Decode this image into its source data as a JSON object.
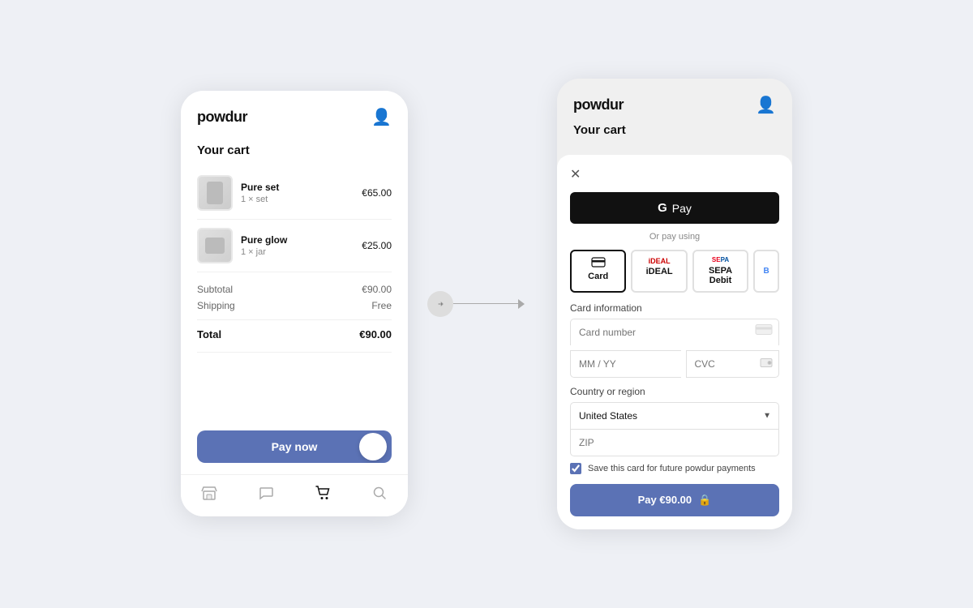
{
  "left_phone": {
    "logo": "powdur",
    "avatar_icon": "👤",
    "cart_title": "Your cart",
    "items": [
      {
        "name": "Pure set",
        "qty": "1 × set",
        "price": "€65.00",
        "img_type": "pure-set"
      },
      {
        "name": "Pure glow",
        "qty": "1 × jar",
        "price": "€25.00",
        "img_type": "pure-glow"
      }
    ],
    "subtotal_label": "Subtotal",
    "subtotal_value": "€90.00",
    "shipping_label": "Shipping",
    "shipping_value": "Free",
    "total_label": "Total",
    "total_value": "€90.00",
    "pay_button_label": "Pay now",
    "nav": {
      "store_icon": "🏪",
      "chat_icon": "💬",
      "cart_icon": "🛒",
      "search_icon": "🔍"
    }
  },
  "arrow": {
    "direction": "→"
  },
  "right_phone": {
    "logo": "powdur",
    "avatar_icon": "👤",
    "cart_title": "Your cart",
    "modal": {
      "close_icon": "✕",
      "gpay_label": "Pay",
      "gpay_g": "G",
      "or_text": "Or pay using",
      "payment_methods": [
        {
          "id": "card",
          "label": "Card",
          "selected": true
        },
        {
          "id": "ideal",
          "label": "iDEAL",
          "selected": false
        },
        {
          "id": "sepa",
          "label": "SEPA Debit",
          "selected": false
        },
        {
          "id": "other",
          "label": "B",
          "selected": false,
          "partial": true
        }
      ],
      "card_info_label": "Card information",
      "card_number_placeholder": "Card number",
      "mm_yy_placeholder": "MM / YY",
      "cvc_placeholder": "CVC",
      "country_label": "Country or region",
      "country_value": "United States",
      "zip_placeholder": "ZIP",
      "save_card_text": "Save this card for future powdur payments",
      "pay_button_label": "Pay €90.00",
      "lock_icon": "🔒"
    }
  }
}
